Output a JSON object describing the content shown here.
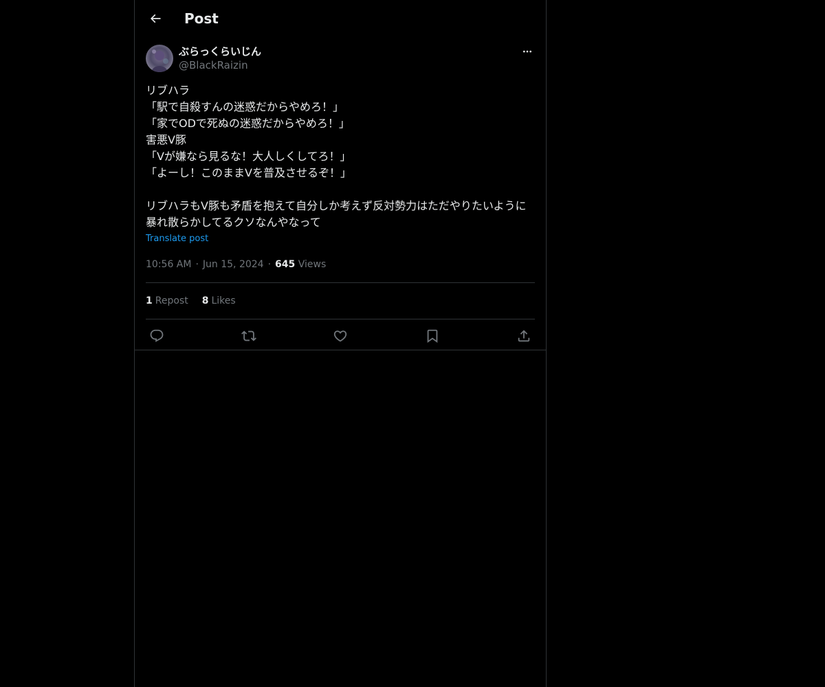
{
  "header": {
    "title": "Post",
    "back_icon": "arrow-left-icon"
  },
  "post": {
    "author": {
      "display_name": "ぶらっくらいじん",
      "handle": "@BlackRaizin"
    },
    "text": "リブハラ\n「駅で自殺すんの迷惑だからやめろ！」\n「家でODで死ぬの迷惑だからやめろ！」\n害悪V豚\n「Vが嫌なら見るな！大人しくしてろ！」\n「よーし！このままVを普及させるぞ！」\n\nリブハラもV豚も矛盾を抱えて自分しか考えず反対勢力はただやりたいように暴れ散らかしてるクソなんやなって",
    "translate_label": "Translate post",
    "time": "10:56 AM",
    "separator": "·",
    "date": "Jun 15, 2024",
    "views_count": "645",
    "views_label": "Views",
    "reposts_count": "1",
    "reposts_label": "Repost",
    "likes_count": "8",
    "likes_label": "Likes"
  },
  "actions": [
    {
      "name": "reply",
      "icon": "reply-icon"
    },
    {
      "name": "repost",
      "icon": "repost-icon"
    },
    {
      "name": "like",
      "icon": "heart-icon"
    },
    {
      "name": "bookmark",
      "icon": "bookmark-icon"
    },
    {
      "name": "share",
      "icon": "share-icon"
    }
  ],
  "colors": {
    "background": "#000000",
    "text_primary": "#e7e9ea",
    "text_secondary": "#71767b",
    "accent": "#1d9bf0",
    "border": "#2f3336"
  }
}
